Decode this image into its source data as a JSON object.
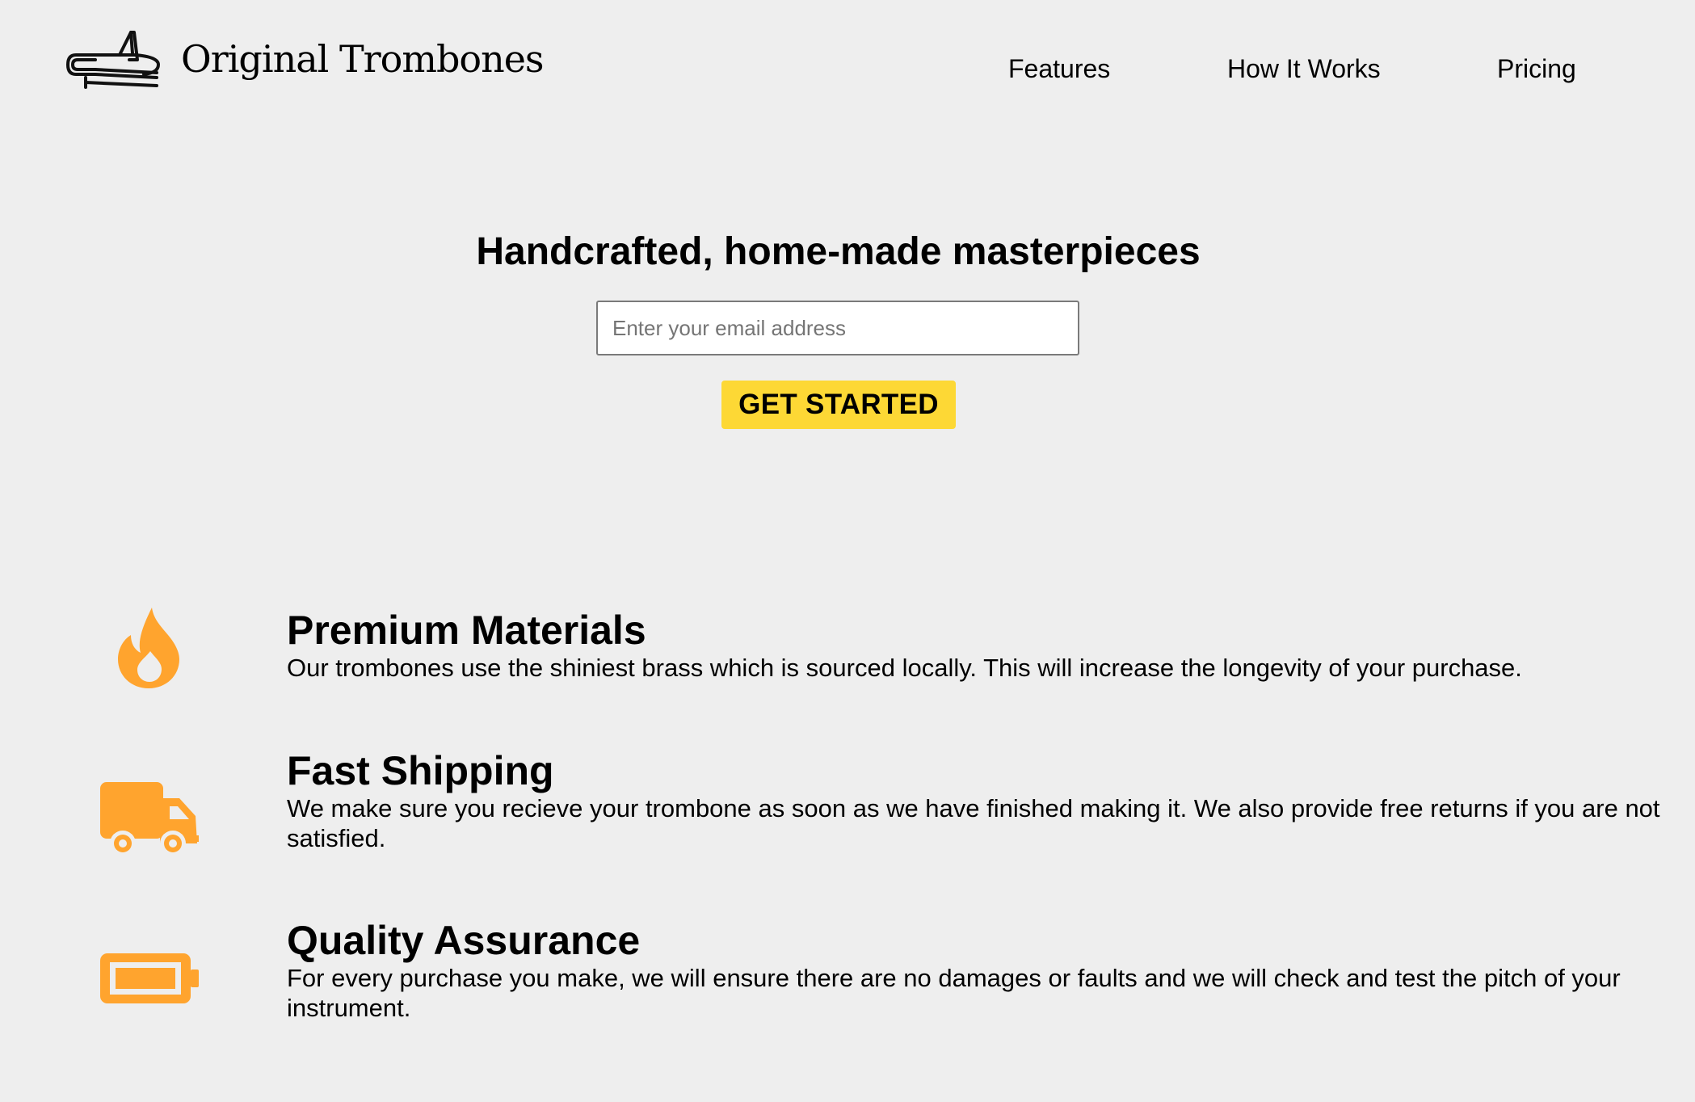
{
  "header": {
    "brand_name": "Original Trombones",
    "logo_icon": "trombone-icon",
    "nav": [
      {
        "label": "Features"
      },
      {
        "label": "How It Works"
      },
      {
        "label": "Pricing"
      }
    ]
  },
  "hero": {
    "title": "Handcrafted, home-made masterpieces",
    "email_placeholder": "Enter your email address",
    "email_value": "",
    "cta_label": "GET STARTED"
  },
  "features": [
    {
      "icon": "flame-icon",
      "title": "Premium Materials",
      "description": "Our trombones use the shiniest brass which is sourced locally. This will increase the longevity of your purchase."
    },
    {
      "icon": "truck-icon",
      "title": "Fast Shipping",
      "description": "We make sure you recieve your trombone as soon as we have finished making it. We also provide free returns if you are not satisfied."
    },
    {
      "icon": "battery-icon",
      "title": "Quality Assurance",
      "description": "For every purchase you make, we will ensure there are no damages or faults and we will check and test the pitch of your instrument."
    }
  ],
  "colors": {
    "background": "#eeeeee",
    "accent_button": "#fdd835",
    "icon_orange": "#ffa42e",
    "text": "#000000",
    "input_border": "#7a7a7a"
  }
}
